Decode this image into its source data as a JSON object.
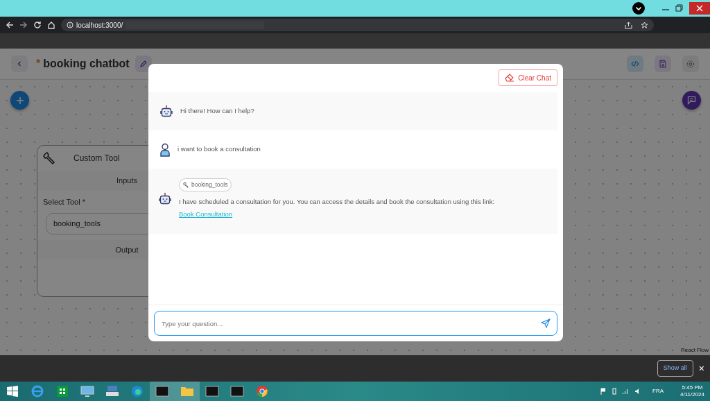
{
  "browser": {
    "url": "localhost:3000/"
  },
  "app_header": {
    "unsaved_mark": "*",
    "title": "booking chatbot"
  },
  "canvas": {
    "node": {
      "title": "Custom Tool",
      "inputs_heading": "Inputs",
      "field_label": "Select Tool",
      "required_mark": "*",
      "field_value": "booking_tools",
      "output_heading": "Output"
    },
    "attribution": "React Flow"
  },
  "chat_dialog": {
    "clear_button": "Clear Chat",
    "messages": [
      {
        "kind": "bot",
        "text": "Hi there! How can I help?"
      },
      {
        "kind": "user",
        "text": "i want to book a consultation"
      },
      {
        "kind": "bot",
        "tool": "booking_tools",
        "text": "I have scheduled a consultation for you. You can access the details and book the consultation using this link:",
        "link": "Book Consultation"
      }
    ],
    "input": {
      "placeholder": "Type your question..."
    }
  },
  "download_bar": {
    "button": "Show all",
    "close": "×"
  },
  "taskbar": {
    "language": "FRA",
    "time": "5:45 PM",
    "date": "4/11/2024"
  }
}
